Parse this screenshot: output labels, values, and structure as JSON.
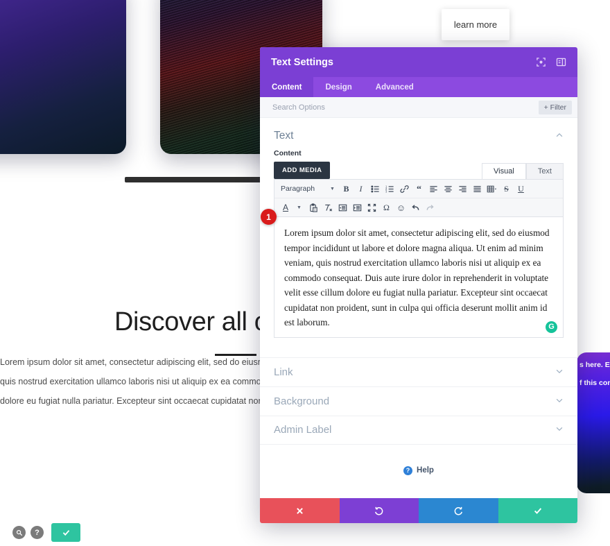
{
  "page": {
    "headline": "Discover all ou",
    "body_copy_lines": [
      "Lorem ipsum dolor sit amet, consectetur adipiscing elit, sed do eiusmod tempor inci",
      "quis nostrud exercitation ullamco laboris nisi ut aliquip ex ea commodo consequat. ",
      "dolore eu fugiat nulla pariatur. Excepteur sint occaecat cupidatat non proident, sunt"
    ],
    "learn_more_label": "learn more",
    "right_card_text_lines": [
      "s here. Edit o",
      "f this conten"
    ]
  },
  "float_controls": {
    "zoom_icon": "magnifier-icon",
    "help_icon": "question-icon",
    "save_icon": "check-icon"
  },
  "modal": {
    "title": "Text Settings",
    "header_icons": [
      {
        "name": "target-icon"
      },
      {
        "name": "layout-panel-icon"
      }
    ],
    "tabs": [
      {
        "label": "Content",
        "active": true
      },
      {
        "label": "Design",
        "active": false
      },
      {
        "label": "Advanced",
        "active": false
      }
    ],
    "search": {
      "placeholder": "Search Options",
      "value": "",
      "filter_label": "+ Filter"
    },
    "text_section": {
      "title": "Text",
      "collapse_icon": "chevron-up-icon",
      "content_label": "Content",
      "add_media_label": "ADD MEDIA",
      "editor_tabs": [
        {
          "label": "Visual",
          "active": true
        },
        {
          "label": "Text",
          "active": false
        }
      ],
      "toolbar_row1": [
        {
          "name": "paragraph-format-select",
          "label": "Paragraph"
        },
        {
          "name": "bold-icon",
          "glyph": "B"
        },
        {
          "name": "italic-icon",
          "glyph": "I"
        },
        {
          "name": "bullet-list-icon",
          "glyph": ""
        },
        {
          "name": "numbered-list-icon",
          "glyph": ""
        },
        {
          "name": "link-icon",
          "glyph": ""
        },
        {
          "name": "blockquote-icon",
          "glyph": "“"
        },
        {
          "name": "align-left-icon",
          "glyph": ""
        },
        {
          "name": "align-center-icon",
          "glyph": ""
        },
        {
          "name": "align-right-icon",
          "glyph": ""
        },
        {
          "name": "align-justify-icon",
          "glyph": ""
        },
        {
          "name": "table-icon",
          "glyph": ""
        },
        {
          "name": "strikethrough-icon",
          "glyph": "S"
        },
        {
          "name": "underline-icon",
          "glyph": "U"
        }
      ],
      "toolbar_row2": [
        {
          "name": "text-color-icon",
          "glyph": "A"
        },
        {
          "name": "paste-as-text-icon",
          "glyph": ""
        },
        {
          "name": "clear-formatting-icon",
          "glyph": ""
        },
        {
          "name": "outdent-icon",
          "glyph": ""
        },
        {
          "name": "indent-icon",
          "glyph": ""
        },
        {
          "name": "fullscreen-icon",
          "glyph": ""
        },
        {
          "name": "special-character-icon",
          "glyph": "Ω"
        },
        {
          "name": "emoji-icon",
          "glyph": "☺"
        },
        {
          "name": "undo-icon",
          "glyph": ""
        },
        {
          "name": "redo-icon",
          "glyph": ""
        }
      ],
      "editor_content": "Lorem ipsum dolor sit amet, consectetur adipiscing elit, sed do eiusmod tempor incididunt ut labore et dolore magna aliqua. Ut enim ad minim veniam, quis nostrud exercitation ullamco laboris nisi ut aliquip ex ea commodo consequat. Duis aute irure dolor in reprehenderit in voluptate velit esse cillum dolore eu fugiat nulla pariatur. Excepteur sint occaecat cupidatat non proident, sunt in culpa qui officia deserunt mollit anim id est laborum.",
      "grammarly_glyph": "G",
      "step_badge": "1"
    },
    "accordion": [
      {
        "label": "Link",
        "icon": "chevron-down-icon"
      },
      {
        "label": "Background",
        "icon": "chevron-down-icon"
      },
      {
        "label": "Admin Label",
        "icon": "chevron-down-icon"
      }
    ],
    "help": {
      "label": "Help",
      "icon": "question-circle-icon"
    },
    "footer_buttons": [
      {
        "name": "cancel-button",
        "icon": "close-icon",
        "color": "#e8515a"
      },
      {
        "name": "undo-button",
        "icon": "undo-icon",
        "color": "#7d3fd4"
      },
      {
        "name": "redo-button",
        "icon": "redo-icon",
        "color": "#2b87d1"
      },
      {
        "name": "save-button",
        "icon": "check-icon",
        "color": "#2ec4a0"
      }
    ]
  },
  "colors": {
    "header_purple": "#7b3fd4",
    "tabs_purple": "#8c4ae0",
    "teal": "#2ec4a0",
    "red": "#e8515a",
    "blue": "#2b87d1",
    "badge_red": "#d91b1b",
    "grammarly_green": "#15c39a"
  }
}
